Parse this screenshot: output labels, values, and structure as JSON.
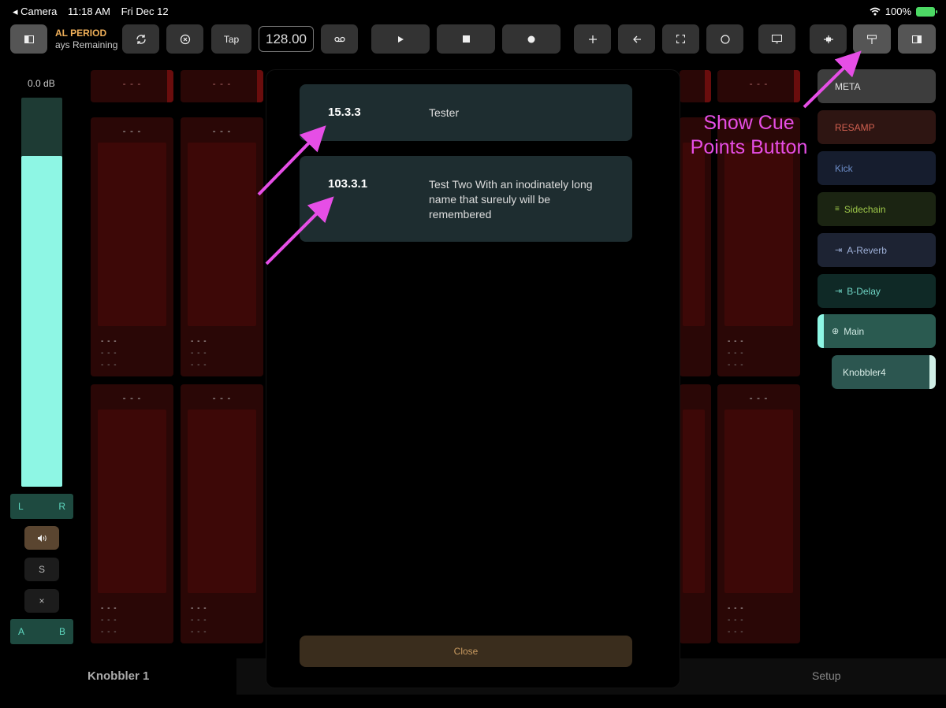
{
  "status_bar": {
    "back_app": "◂ Camera",
    "time": "11:18 AM",
    "date": "Fri Dec 12",
    "battery": "100%"
  },
  "toolbar": {
    "trial_line1": "AL PERIOD",
    "trial_line2": "ays Remaining",
    "tap_label": "Tap",
    "tempo_value": "128.00"
  },
  "left_strip": {
    "gain": "0.0 dB",
    "meter_level": 0.85,
    "pan_left": "L",
    "pan_right": "R",
    "solo_label": "S",
    "mute_label": "×",
    "ab_left": "A",
    "ab_right": "B"
  },
  "channel_placeholder": "- - -",
  "modal": {
    "cues": [
      {
        "number": "15.3.3",
        "name": "Tester"
      },
      {
        "number": "103.3.1",
        "name": "Test Two With an inodinately long name that sureuly will be remembered"
      }
    ],
    "close_label": "Close"
  },
  "routing": [
    {
      "label": "META",
      "color": "#e0e0e0",
      "bg": "#3d3d3d"
    },
    {
      "label": "RESAMP",
      "color": "#d06050",
      "bg": "#2e1512"
    },
    {
      "label": "Kick",
      "color": "#6d8ec9",
      "bg": "#161d2e"
    },
    {
      "label": "Sidechain",
      "color": "#9fc94a",
      "bg": "#1b2412"
    },
    {
      "label": "A-Reverb",
      "color": "#9eb0d8",
      "bg": "#1d2333"
    },
    {
      "label": "B-Delay",
      "color": "#6fd4c4",
      "bg": "#0f2926"
    },
    {
      "label": "Main",
      "color": "#cfe8e2",
      "bg": "#2a5a50"
    },
    {
      "label": "Knobbler4",
      "color": "#d8ece6",
      "bg": "#2c5650"
    }
  ],
  "bottom": {
    "device_name": "Knobbler 1",
    "setup_label": "Setup"
  },
  "annotation": {
    "line1": "Show Cue",
    "line2": "Points Button",
    "color": "#e64ee6"
  }
}
